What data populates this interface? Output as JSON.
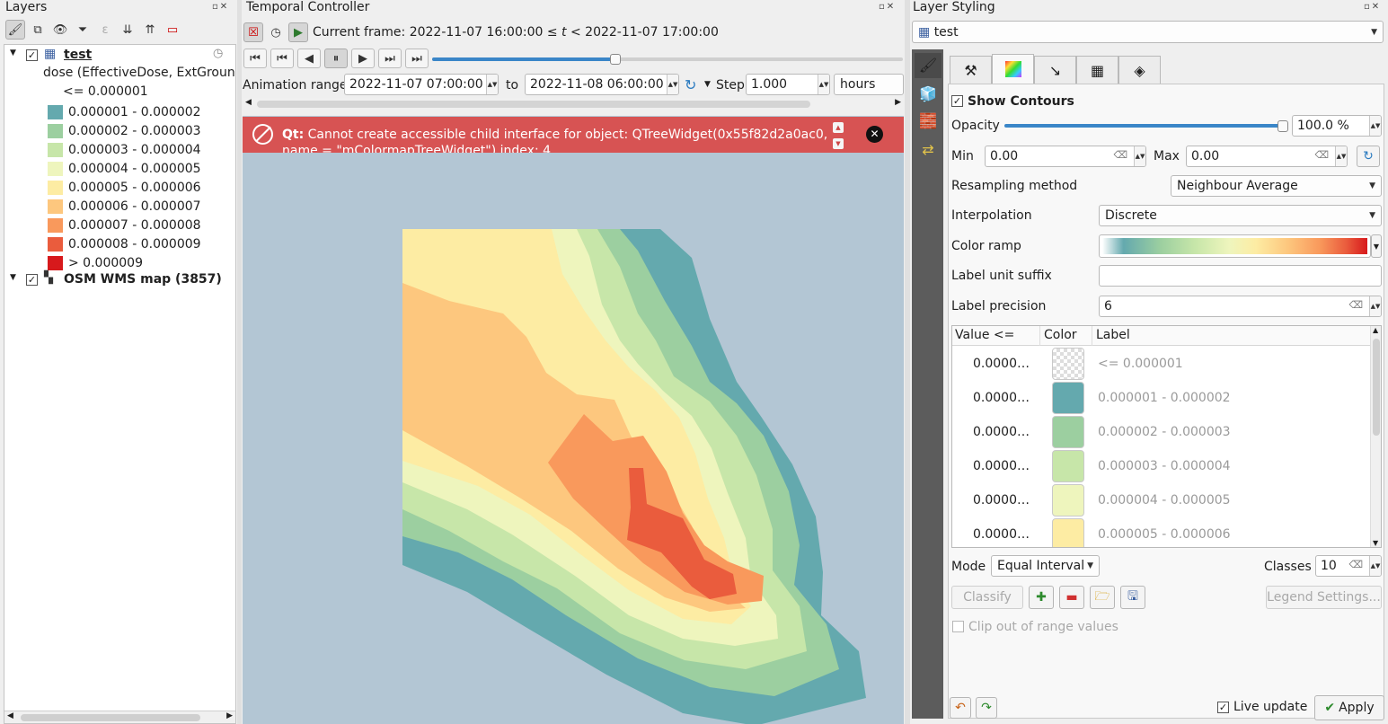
{
  "layers_panel": {
    "title": "Layers",
    "layer1": {
      "name": "test",
      "sub": "dose (EffectiveDose, ExtGroundY",
      "first_class": "<= 0.000001"
    },
    "legend": [
      {
        "label": "0.000001 - 0.000002",
        "color": "#64a9ae"
      },
      {
        "label": "0.000002 - 0.000003",
        "color": "#9ccfa0"
      },
      {
        "label": "0.000003 - 0.000004",
        "color": "#c7e6a9"
      },
      {
        "label": "0.000004 - 0.000005",
        "color": "#eef5bd"
      },
      {
        "label": "0.000005 - 0.000006",
        "color": "#fdeca3"
      },
      {
        "label": "0.000006 - 0.000007",
        "color": "#fdc77e"
      },
      {
        "label": "0.000007 - 0.000008",
        "color": "#f9995c"
      },
      {
        "label": "0.000008 - 0.000009",
        "color": "#ea5c3d"
      },
      {
        "label": "> 0.000009",
        "color": "#d7191c"
      }
    ],
    "layer2": {
      "name": "OSM WMS map (3857)"
    }
  },
  "temporal": {
    "title": "Temporal Controller",
    "current_frame_prefix": "Current frame: 2022-11-07 16:00:00 ≤",
    "current_frame_t": "t",
    "current_frame_suffix": "< 2022-11-07 17:00:00",
    "animation_range_label": "Animation range",
    "range_start": "2022-11-07 07:00:00",
    "to_label": "to",
    "range_end": "2022-11-08 06:00:00",
    "step_label": "Step",
    "step_value": "1.000",
    "step_unit": "hours",
    "slider_fraction": 0.39
  },
  "error": {
    "prefix": "Qt:",
    "message": "Cannot create accessible child interface for object: QTreeWidget(0x55f82d2a0ac0,",
    "message2": "name = \"mColormapTreeWidget\") index: 4"
  },
  "styling": {
    "title": "Layer Styling",
    "layer_select": "test",
    "show_contours": "Show Contours",
    "opacity_label": "Opacity",
    "opacity_value": "100.0 %",
    "min_label": "Min",
    "min_value": "0.00",
    "max_label": "Max",
    "max_value": "0.00",
    "resampling_label": "Resampling method",
    "resampling_value": "Neighbour Average",
    "interpolation_label": "Interpolation",
    "interpolation_value": "Discrete",
    "color_ramp_label": "Color ramp",
    "unit_suffix_label": "Label unit suffix",
    "unit_suffix_value": "",
    "precision_label": "Label precision",
    "precision_value": "6",
    "table_headers": [
      "Value <=",
      "Color",
      "Label"
    ],
    "table_rows": [
      {
        "value": "0.0000…",
        "label": "<= 0.000001",
        "color": "transparent"
      },
      {
        "value": "0.0000…",
        "label": "0.000001 - 0.000002",
        "color": "#64a9ae"
      },
      {
        "value": "0.0000…",
        "label": "0.000002 - 0.000003",
        "color": "#9ccfa0"
      },
      {
        "value": "0.0000…",
        "label": "0.000003 - 0.000004",
        "color": "#c7e6a9"
      },
      {
        "value": "0.0000…",
        "label": "0.000004 - 0.000005",
        "color": "#eef5bd"
      },
      {
        "value": "0.0000…",
        "label": "0.000005 - 0.000006",
        "color": "#fdeca3"
      }
    ],
    "mode_label": "Mode",
    "mode_value": "Equal Interval",
    "classes_label": "Classes",
    "classes_value": "10",
    "classify_label": "Classify",
    "legend_settings_label": "Legend Settings...",
    "clip_label": "Clip out of range values",
    "live_update_label": "Live update",
    "apply_label": "Apply"
  },
  "map": {
    "background": "#b3c6d4"
  }
}
